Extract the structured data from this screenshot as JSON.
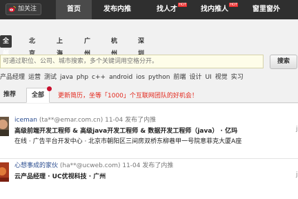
{
  "nav": {
    "follow_label": "加关注",
    "items": [
      {
        "label": "首页",
        "hot": ""
      },
      {
        "label": "发布内推",
        "hot": ""
      },
      {
        "label": "找人才",
        "hot": "HOT"
      },
      {
        "label": "找内推人",
        "hot": "HOT"
      },
      {
        "label": "窗里窗外",
        "hot": ""
      }
    ]
  },
  "cities": [
    "全部",
    "北京",
    "上海",
    "广州",
    "杭州",
    "深圳"
  ],
  "search": {
    "placeholder": "可通过职位、公司、城市搜索，多个关键词用空格分开。",
    "button_label": "搜索"
  },
  "keywords": [
    "产品经理",
    "运营",
    "测试",
    "java",
    "php",
    "c++",
    "android",
    "ios",
    "python",
    "前端",
    "设计",
    "UI",
    "视觉",
    "实习"
  ],
  "tabs": {
    "recommend": "推荐",
    "all": "全部",
    "promo": "更新简历，坐等「1000」个互联网团队的好机会！"
  },
  "feed": [
    {
      "username": "iceman",
      "email": "(ta**@emar.com.cn)",
      "posted": "11-04 发布了内推",
      "title": "高级前端开发工程师 & 高级java开发工程师 & 数据开发工程师（java） · 亿玛",
      "line2": "在线 · 广告平台开发中心 · 北京市朝阳区三间房双桥东柳巷甲一号院意菲克大厦A座"
    },
    {
      "username": "心想事成的家伙",
      "email": "(ha**@ucweb.com)",
      "posted": "11-04 发布了内推",
      "title": "云产品经理 · UC优视科技 · 广州",
      "line2": ""
    }
  ]
}
